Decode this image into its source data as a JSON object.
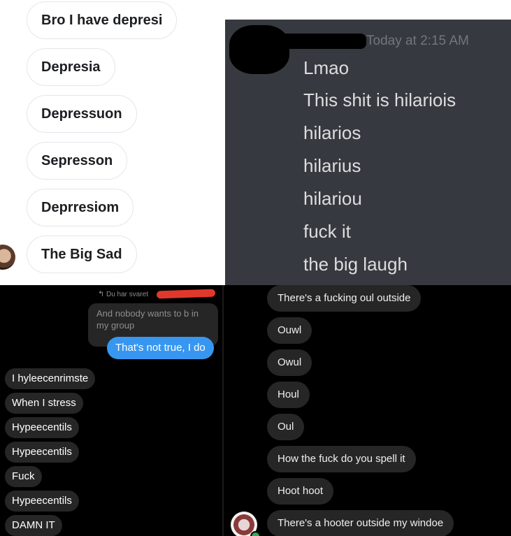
{
  "panel1": {
    "bubbles": [
      "Bro I have depresi",
      "Depresia",
      "Depressuon",
      "Sepresson",
      "Deprresiom",
      "The Big Sad"
    ]
  },
  "panel2": {
    "timestamp": "Today at 2:15 AM",
    "lines": [
      "Lmao",
      "This shit is hilariois",
      "hilarios",
      "hilarius",
      "hilariou",
      "fuck it",
      "the big laugh"
    ]
  },
  "panel3": {
    "reply_label": "Du har svaret",
    "quoted_message": "And nobody wants to b in my group",
    "sent_message": "That's not true, I do",
    "messages": [
      "I hyleecenrimste",
      "When I stress",
      "Hypeecentils",
      "Hypeecentils",
      "Fuck",
      "Hypeecentils",
      "DAMN IT"
    ]
  },
  "panel4": {
    "messages": [
      "There's a fucking oul outside",
      "Ouwl",
      "Owul",
      "Houl",
      "Oul",
      "How the fuck do you spell it",
      "Hoot hoot",
      "There's a hooter outside my windoe"
    ]
  },
  "colors": {
    "discord_bg": "#36393f",
    "instagram_blue": "#3797f0",
    "dark_bubble": "#262626",
    "redaction": "#e0392b"
  }
}
